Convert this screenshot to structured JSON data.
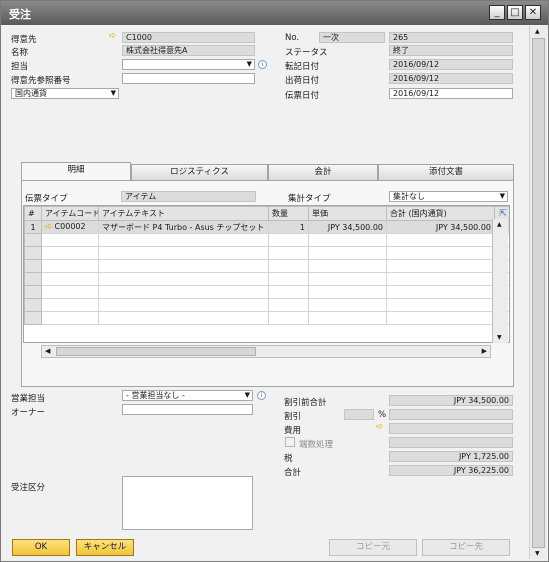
{
  "window": {
    "title": "受注"
  },
  "header_left": {
    "customer_label": "得意先",
    "customer_value": "C1000",
    "name_label": "名称",
    "name_value": "株式会社得意先A",
    "contact_label": "担当",
    "contact_value": "",
    "ref_label": "得意先参照番号",
    "ref_value": "",
    "currency_value": "国内通貨"
  },
  "header_right": {
    "no_label": "No.",
    "series_value": "一次",
    "no_value": "265",
    "status_label": "ステータス",
    "status_value": "終了",
    "posting_label": "転記日付",
    "posting_value": "2016/09/12",
    "delivery_label": "出荷日付",
    "delivery_value": "2016/09/12",
    "doc_date_label": "伝票日付",
    "doc_date_value": "2016/09/12"
  },
  "tabs": [
    {
      "label": "明細"
    },
    {
      "label": "ロジスティクス"
    },
    {
      "label": "会計"
    },
    {
      "label": "添付文書"
    }
  ],
  "contents": {
    "doc_type_label": "伝票タイプ",
    "doc_type_value": "アイテム",
    "summary_label": "集計タイプ",
    "summary_value": "集計なし"
  },
  "grid": {
    "columns": [
      "#",
      "アイテムコード",
      "アイテムテキスト",
      "数量",
      "単価",
      "合計 (国内通貨)"
    ],
    "rows": [
      {
        "num": "1",
        "code": "C00002",
        "text": "マザーボード P4 Turbo - Asus チップセット",
        "qty": "1",
        "price": "JPY 34,500.00",
        "total": "JPY 34,500.00"
      }
    ]
  },
  "footer_left": {
    "sales_emp_label": "営業担当",
    "sales_emp_value": "- 営業担当なし -",
    "owner_label": "オーナー",
    "owner_value": "",
    "remarks_label": "受注区分"
  },
  "totals": {
    "before_discount_label": "割引前合計",
    "before_discount_value": "JPY 34,500.00",
    "discount_label": "割引",
    "discount_pct_symbol": "%",
    "freight_label": "費用",
    "rounding_label": "端数処理",
    "tax_label": "税",
    "tax_value": "JPY 1,725.00",
    "total_label": "合計",
    "total_value": "JPY 36,225.00"
  },
  "buttons": {
    "ok": "OK",
    "cancel": "キャンセル",
    "copy_from": "コピー元",
    "copy_to": "コピー先"
  },
  "colors": {
    "accent": "#f2c23a",
    "readonly": "#dcdcdc",
    "link_arrow": "#e0a800"
  }
}
